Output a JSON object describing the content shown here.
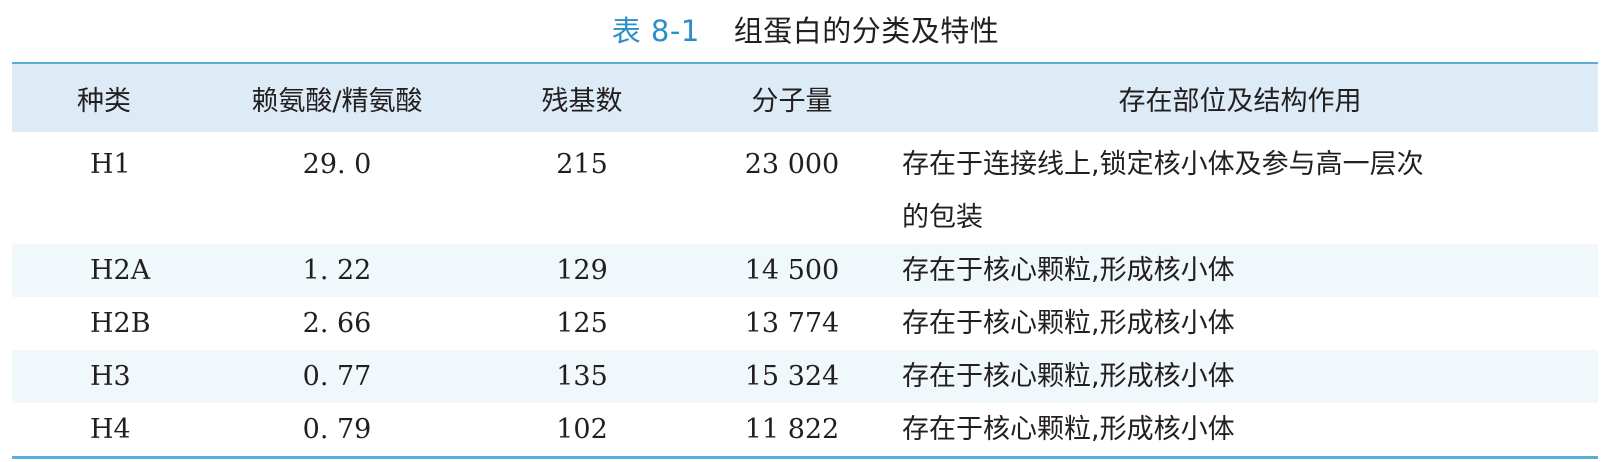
{
  "caption": {
    "number": "表 8-1",
    "title": "组蛋白的分类及特性"
  },
  "table": {
    "headers": [
      "种类",
      "赖氨酸/精氨酸",
      "残基数",
      "分子量",
      "存在部位及结构作用"
    ],
    "rows": [
      {
        "type": "H1",
        "ratio": "29. 0",
        "residues": "215",
        "mass": "23 000",
        "role_line1": "存在于连接线上,锁定核小体及参与高一层次",
        "role_line2": "的包装"
      },
      {
        "type": "H2A",
        "ratio": "1. 22",
        "residues": "129",
        "mass": "14 500",
        "role_line1": "存在于核心颗粒,形成核小体"
      },
      {
        "type": "H2B",
        "ratio": "2. 66",
        "residues": "125",
        "mass": "13 774",
        "role_line1": "存在于核心颗粒,形成核小体"
      },
      {
        "type": "H3",
        "ratio": "0. 77",
        "residues": "135",
        "mass": "15 324",
        "role_line1": "存在于核心颗粒,形成核小体"
      },
      {
        "type": "H4",
        "ratio": "0. 79",
        "residues": "102",
        "mass": "11 822",
        "role_line1": "存在于核心颗粒,形成核小体"
      }
    ]
  }
}
